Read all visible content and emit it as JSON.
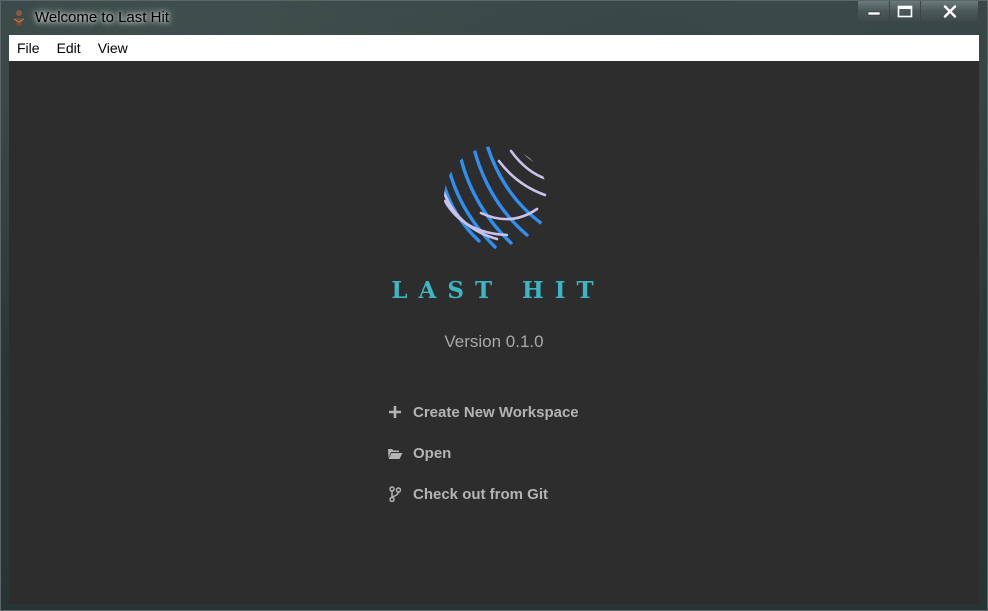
{
  "window": {
    "title": "Welcome to Last Hit",
    "controls": [
      "minimize-icon",
      "maximize-icon",
      "close-icon"
    ]
  },
  "menubar": {
    "items": [
      {
        "label": "File"
      },
      {
        "label": "Edit"
      },
      {
        "label": "View"
      }
    ]
  },
  "welcome": {
    "app_name": "LAST HIT",
    "version": "Version 0.1.0",
    "logo_icon": "striped-globe-logo",
    "actions": [
      {
        "icon": "plus-icon",
        "label": "Create New Workspace"
      },
      {
        "icon": "folder-open-icon",
        "label": "Open"
      },
      {
        "icon": "git-branch-icon",
        "label": "Check out from Git"
      }
    ]
  },
  "colors": {
    "background": "#2d2d2d",
    "brand_teal": "#3db6c4",
    "logo_blue": "#2f8ff0",
    "logo_lavender": "#c9c3ec",
    "action_text": "#b4b4b4",
    "version_text": "#a8a8a8"
  }
}
